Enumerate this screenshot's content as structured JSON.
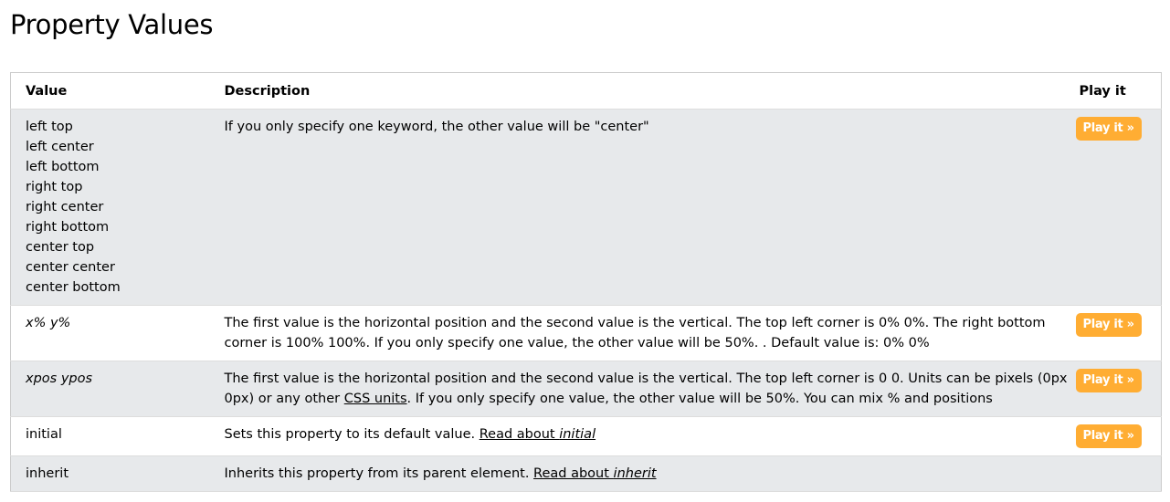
{
  "page": {
    "title": "Property Values"
  },
  "table": {
    "headers": {
      "value": "Value",
      "description": "Description",
      "play": "Play it"
    },
    "play_label": "Play it »",
    "rows": [
      {
        "value_lines": [
          "left top",
          "left center",
          "left bottom",
          "right top",
          "right center",
          "right bottom",
          "center top",
          "center center",
          "center bottom"
        ],
        "description": "If you only specify one keyword, the other value will be \"center\""
      },
      {
        "value": "x% y%",
        "description": "The first value is the horizontal position and the second value is the vertical. The top left corner is 0% 0%. The right bottom corner is 100% 100%. If you only specify one value, the other value will be 50%. . Default value is: 0% 0%"
      },
      {
        "value": "xpos ypos",
        "description_before": "The first value is the horizontal position and the second value is the vertical. The top left corner is 0 0. Units can be pixels (0px 0px) or any other ",
        "description_link": "CSS units",
        "description_after": ". If you only specify one value, the other value will be 50%. You can mix % and positions"
      },
      {
        "value": "initial",
        "description": "Sets this property to its default value. ",
        "link_prefix": "Read about ",
        "link_keyword": "initial"
      },
      {
        "value": "inherit",
        "description": "Inherits this property from its parent element. ",
        "link_prefix": "Read about ",
        "link_keyword": "inherit"
      }
    ]
  },
  "colors": {
    "play_button": "#ffad33",
    "row_stripe": "#e7e9eb",
    "border": "#cccccc"
  }
}
